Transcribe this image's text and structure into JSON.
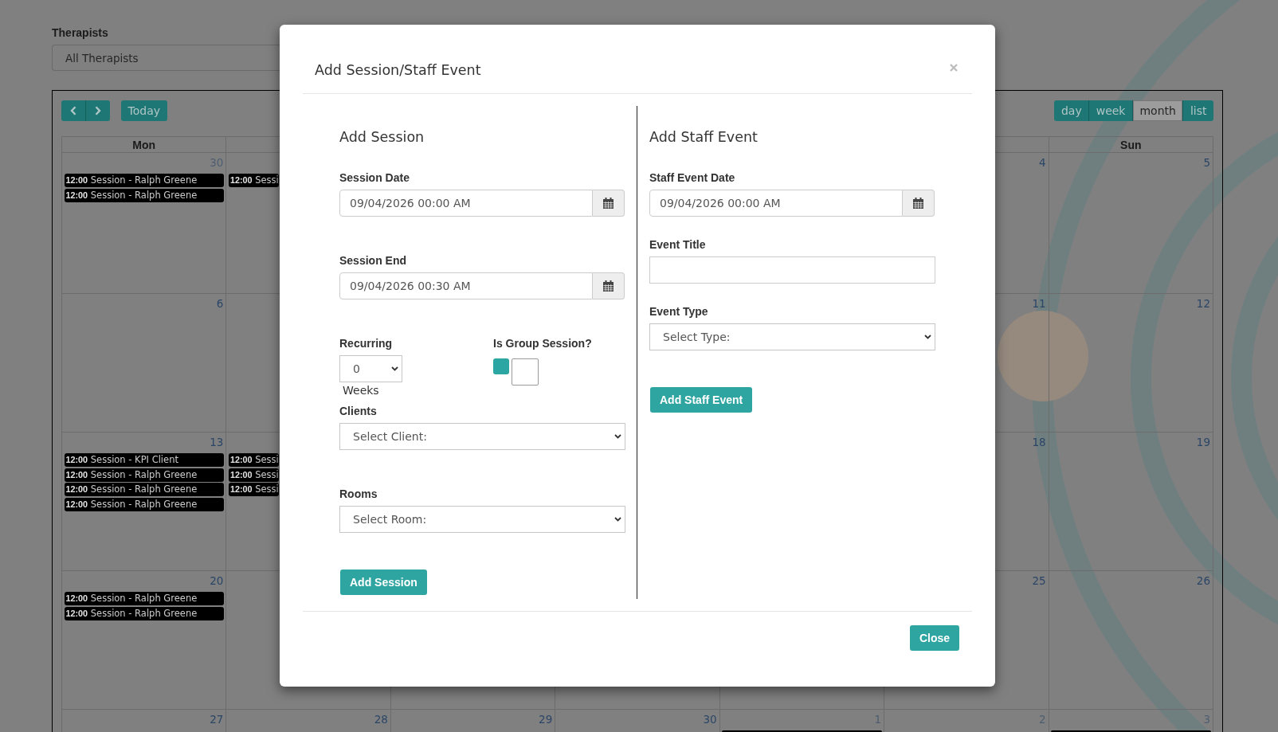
{
  "therapist_filter": {
    "label": "Therapists",
    "value": "All Therapists"
  },
  "calendar": {
    "today_button": "Today",
    "views": [
      {
        "label": "day",
        "selected": false
      },
      {
        "label": "week",
        "selected": false
      },
      {
        "label": "month",
        "selected": true
      },
      {
        "label": "list",
        "selected": false
      }
    ],
    "weekday_headers": {
      "mon": "Mon",
      "sun": "Sun"
    },
    "weeks": [
      {
        "days": {
          "mon": {
            "day": "30",
            "other_month": true,
            "events": [
              {
                "time": "12:00",
                "title": "Session - Ralph Greene",
                "cut_off": false
              },
              {
                "time": "12:00",
                "title": "Session - Ralph Greene",
                "cut_off": false
              }
            ]
          },
          "tue": {
            "events": [
              {
                "time": "12:00",
                "title": "Sessi",
                "cut_off": false
              }
            ]
          },
          "sat": {
            "day": "4",
            "other_month": false
          },
          "sun": {
            "day": "5",
            "other_month": false
          }
        }
      },
      {
        "days": {
          "mon": {
            "day": "6",
            "other_month": false
          },
          "sat": {
            "day": "11",
            "other_month": false
          },
          "sun": {
            "day": "12",
            "other_month": false
          }
        }
      },
      {
        "days": {
          "mon": {
            "day": "13",
            "other_month": false,
            "events": [
              {
                "time": "12:00",
                "title": "Session - KPI Client",
                "cut_off": false
              },
              {
                "time": "12:00",
                "title": "Session - Ralph Greene",
                "cut_off": false
              },
              {
                "time": "12:00",
                "title": "Session - Ralph Greene",
                "cut_off": false
              },
              {
                "time": "12:00",
                "title": "Session - Ralph Greene",
                "cut_off": false
              }
            ]
          },
          "tue": {
            "events": [
              {
                "time": "12:00",
                "title": "Sessi",
                "cut_off": false
              },
              {
                "time": "12:00",
                "title": "Sessi",
                "cut_off": false
              },
              {
                "time": "12:00",
                "title": "Sessi",
                "cut_off": false
              }
            ]
          },
          "sat": {
            "day": "18",
            "other_month": false
          },
          "sun": {
            "day": "19",
            "other_month": false
          }
        }
      },
      {
        "days": {
          "mon": {
            "day": "20",
            "other_month": false,
            "events": [
              {
                "time": "12:00",
                "title": "Session - Ralph Greene",
                "cut_off": false
              },
              {
                "time": "12:00",
                "title": "Session - Ralph Greene",
                "cut_off": false
              }
            ]
          },
          "sat": {
            "day": "25",
            "other_month": false
          },
          "sun": {
            "day": "26",
            "other_month": false
          }
        }
      },
      {
        "days": {
          "mon": {
            "day": "27",
            "other_month": false
          },
          "tue": {
            "day": "28",
            "other_month": false
          },
          "wed": {
            "day": "29",
            "other_month": false
          },
          "thu": {
            "day": "30",
            "other_month": false
          },
          "fri": {
            "day": "1",
            "other_month": true,
            "events": [
              {
                "cut_off": true
              }
            ]
          },
          "sat": {
            "day": "2",
            "other_month": true
          },
          "sun": {
            "day": "3",
            "other_month": true,
            "events": [
              {
                "cut_off": true
              }
            ]
          }
        }
      }
    ]
  },
  "modal": {
    "title": "Add Session/Staff Event",
    "session": {
      "heading": "Add Session",
      "session_date": {
        "label": "Session Date",
        "value": "09/04/2026 00:00 AM"
      },
      "session_end": {
        "label": "Session End",
        "value": "09/04/2026 00:30 AM"
      },
      "recurring": {
        "label": "Recurring",
        "value": "0",
        "unit": "Weeks"
      },
      "group_session": {
        "label": "Is Group Session?",
        "checked": false
      },
      "clients": {
        "label": "Clients",
        "value": "Select Client:"
      },
      "rooms": {
        "label": "Rooms",
        "value": "Select Room:"
      },
      "submit_button": "Add Session"
    },
    "staff_event": {
      "heading": "Add Staff Event",
      "date": {
        "label": "Staff Event Date",
        "value": "09/04/2026 00:00 AM"
      },
      "title_field": {
        "label": "Event Title"
      },
      "type": {
        "label": "Event Type",
        "value": "Select Type:"
      },
      "submit_button": "Add Staff Event"
    },
    "close_button": "Close"
  }
}
